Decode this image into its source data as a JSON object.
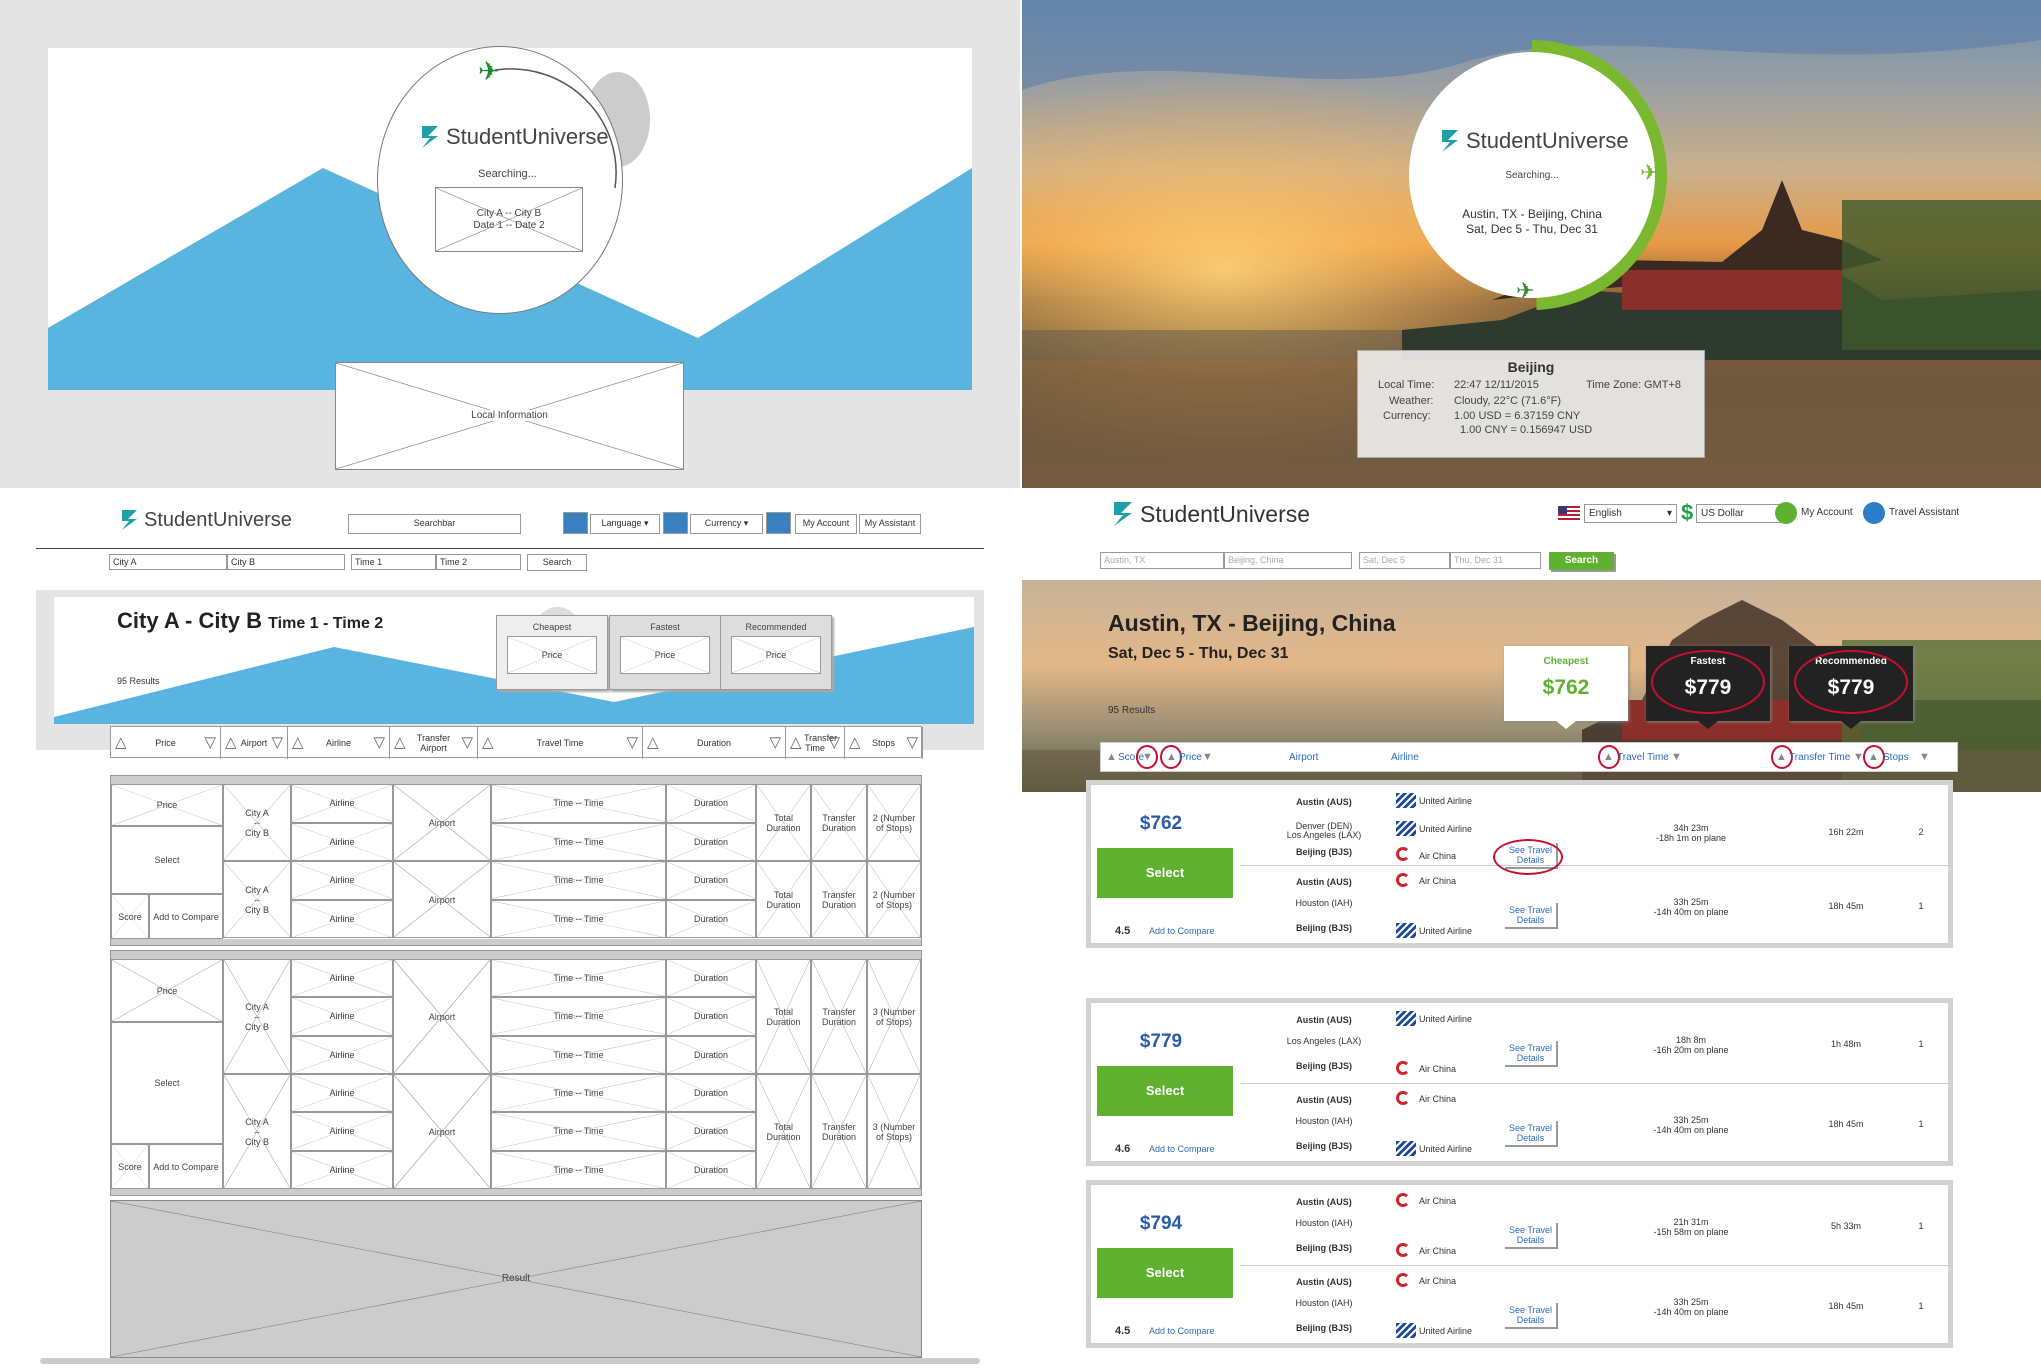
{
  "wireframe_loading": {
    "logo": "StudentUniverse",
    "status": "Searching...",
    "route_line1": "City A -- City B",
    "route_line2": "Date 1 -- Date 2",
    "local_info": "Local Information"
  },
  "real_loading": {
    "logo": "StudentUniverse",
    "status": "Searching...",
    "route": "Austin, TX - Beijing, China",
    "dates": "Sat, Dec 5 - Thu, Dec 31",
    "info": {
      "city": "Beijing",
      "local_time_label": "Local Time:",
      "local_time": "22:47 12/11/2015",
      "tz_label": "Time Zone:",
      "tz": "GMT+8",
      "weather_label": "Weather:",
      "weather": "Cloudy, 22°C (71.6°F)",
      "currency_label": "Currency:",
      "currency1": "1.00 USD = 6.37159 CNY",
      "currency2": "1.00 CNY = 0.156947 USD"
    }
  },
  "wireframe_results": {
    "logo": "StudentUniverse",
    "searchbar": "Searchbar",
    "language": "Language",
    "currency": "Currency",
    "my_account": "My Account",
    "my_assistant": "My Assistant",
    "fields": [
      "City A",
      "City B",
      "Time 1",
      "Time 2"
    ],
    "search": "Search",
    "title": "City A - City B",
    "title_time": "Time 1 - Time 2",
    "results": "95 Results",
    "cards": [
      {
        "label": "Cheapest",
        "price": "Price"
      },
      {
        "label": "Fastest",
        "price": "Price"
      },
      {
        "label": "Recommended",
        "price": "Price"
      }
    ],
    "headers": [
      "Price",
      "Airport",
      "Airline",
      "Transfer Airport",
      "Travel Time",
      "Duration",
      "Transfer Time",
      "Stops"
    ],
    "cell": {
      "price": "Price",
      "select": "Select",
      "score": "Score",
      "compare": "Add to Compare",
      "city_a": "City A",
      "dashes": "--",
      "city_b": "City B",
      "airline": "Airline",
      "airport": "Airport",
      "time": "Time -- Time",
      "duration": "Duration",
      "total_duration": "Total Duration",
      "transfer_duration": "Transfer Duration",
      "stops2": "2 (Number of Stops)",
      "stops3": "3 (Number of Stops)"
    },
    "result": "Result"
  },
  "real_results": {
    "logo": "StudentUniverse",
    "language": "English",
    "currency": "US Dollar",
    "my_account": "My Account",
    "travel_assistant": "Travel Assistant",
    "from": "Austin, TX",
    "to": "Beijing, China",
    "depart": "Sat, Dec 5",
    "return": "Thu, Dec 31",
    "search": "Search",
    "title": "Austin, TX - Beijing, China",
    "dates": "Sat, Dec 5 - Thu, Dec 31",
    "results": "95 Results",
    "cards": [
      {
        "label": "Cheapest",
        "price": "$762"
      },
      {
        "label": "Fastest",
        "price": "$779"
      },
      {
        "label": "Recommended",
        "price": "$779"
      }
    ],
    "headers": {
      "score": "Score",
      "price": "Price",
      "airport": "Airport",
      "airline": "Airline",
      "travel_time": "Travel Time",
      "transfer_time": "Transfer Time",
      "stops": "Stops"
    },
    "select": "Select",
    "add_compare": "Add to Compare",
    "see1": "See Travel",
    "see2": "Details",
    "groups": [
      {
        "price": "$762",
        "score": "4.5",
        "legs": [
          {
            "a1": "Austin (AUS)",
            "a2": "Denver (DEN)",
            "a2b": "Los Angeles (LAX)",
            "a3": "Beijing (BJS)",
            "l1": "United Airline",
            "l2": "United Airline",
            "l3": "Air China",
            "tt1": "34h 23m",
            "tt2": "-18h 1m on plane",
            "xfer": "16h 22m",
            "stops": "2"
          },
          {
            "a1": "Austin (AUS)",
            "a2": "Houston (IAH)",
            "a2b": "",
            "a3": "Beijing (BJS)",
            "l1": "Air China",
            "l2": "",
            "l3": "United Airline",
            "tt1": "33h 25m",
            "tt2": "-14h 40m on plane",
            "xfer": "18h 45m",
            "stops": "1"
          }
        ]
      },
      {
        "price": "$779",
        "score": "4.6",
        "legs": [
          {
            "a1": "Austin (AUS)",
            "a2": "Los Angeles (LAX)",
            "a2b": "",
            "a3": "Beijing (BJS)",
            "l1": "United Airline",
            "l2": "",
            "l3": "Air China",
            "tt1": "18h 8m",
            "tt2": "-16h 20m on plane",
            "xfer": "1h 48m",
            "stops": "1"
          },
          {
            "a1": "Austin (AUS)",
            "a2": "Houston (IAH)",
            "a2b": "",
            "a3": "Beijing (BJS)",
            "l1": "Air China",
            "l2": "",
            "l3": "United Airline",
            "tt1": "33h 25m",
            "tt2": "-14h 40m on plane",
            "xfer": "18h 45m",
            "stops": "1"
          }
        ]
      },
      {
        "price": "$794",
        "score": "4.5",
        "legs": [
          {
            "a1": "Austin (AUS)",
            "a2": "Houston (IAH)",
            "a2b": "",
            "a3": "Beijing (BJS)",
            "l1": "Air China",
            "l2": "",
            "l3": "Air China",
            "tt1": "21h 31m",
            "tt2": "-15h 58m on plane",
            "xfer": "5h 33m",
            "stops": "1"
          },
          {
            "a1": "Austin (AUS)",
            "a2": "Houston (IAH)",
            "a2b": "",
            "a3": "Beijing (BJS)",
            "l1": "Air China",
            "l2": "",
            "l3": "United Airline",
            "tt1": "33h 25m",
            "tt2": "-14h 40m on plane",
            "xfer": "18h 45m",
            "stops": "1"
          }
        ]
      }
    ]
  },
  "colors": {
    "accent_blue": "#5ab4e0",
    "green": "#5fb12f",
    "price_blue": "#2a5ca8",
    "red_annot": "#c8102e"
  }
}
